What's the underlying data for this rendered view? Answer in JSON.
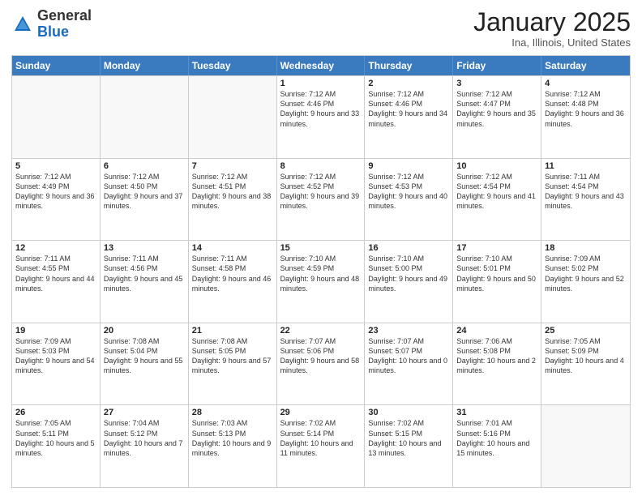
{
  "logo": {
    "general": "General",
    "blue": "Blue"
  },
  "header": {
    "title": "January 2025",
    "subtitle": "Ina, Illinois, United States"
  },
  "weekdays": [
    "Sunday",
    "Monday",
    "Tuesday",
    "Wednesday",
    "Thursday",
    "Friday",
    "Saturday"
  ],
  "weeks": [
    [
      {
        "day": "",
        "info": ""
      },
      {
        "day": "",
        "info": ""
      },
      {
        "day": "",
        "info": ""
      },
      {
        "day": "1",
        "info": "Sunrise: 7:12 AM\nSunset: 4:46 PM\nDaylight: 9 hours and 33 minutes."
      },
      {
        "day": "2",
        "info": "Sunrise: 7:12 AM\nSunset: 4:46 PM\nDaylight: 9 hours and 34 minutes."
      },
      {
        "day": "3",
        "info": "Sunrise: 7:12 AM\nSunset: 4:47 PM\nDaylight: 9 hours and 35 minutes."
      },
      {
        "day": "4",
        "info": "Sunrise: 7:12 AM\nSunset: 4:48 PM\nDaylight: 9 hours and 36 minutes."
      }
    ],
    [
      {
        "day": "5",
        "info": "Sunrise: 7:12 AM\nSunset: 4:49 PM\nDaylight: 9 hours and 36 minutes."
      },
      {
        "day": "6",
        "info": "Sunrise: 7:12 AM\nSunset: 4:50 PM\nDaylight: 9 hours and 37 minutes."
      },
      {
        "day": "7",
        "info": "Sunrise: 7:12 AM\nSunset: 4:51 PM\nDaylight: 9 hours and 38 minutes."
      },
      {
        "day": "8",
        "info": "Sunrise: 7:12 AM\nSunset: 4:52 PM\nDaylight: 9 hours and 39 minutes."
      },
      {
        "day": "9",
        "info": "Sunrise: 7:12 AM\nSunset: 4:53 PM\nDaylight: 9 hours and 40 minutes."
      },
      {
        "day": "10",
        "info": "Sunrise: 7:12 AM\nSunset: 4:54 PM\nDaylight: 9 hours and 41 minutes."
      },
      {
        "day": "11",
        "info": "Sunrise: 7:11 AM\nSunset: 4:54 PM\nDaylight: 9 hours and 43 minutes."
      }
    ],
    [
      {
        "day": "12",
        "info": "Sunrise: 7:11 AM\nSunset: 4:55 PM\nDaylight: 9 hours and 44 minutes."
      },
      {
        "day": "13",
        "info": "Sunrise: 7:11 AM\nSunset: 4:56 PM\nDaylight: 9 hours and 45 minutes."
      },
      {
        "day": "14",
        "info": "Sunrise: 7:11 AM\nSunset: 4:58 PM\nDaylight: 9 hours and 46 minutes."
      },
      {
        "day": "15",
        "info": "Sunrise: 7:10 AM\nSunset: 4:59 PM\nDaylight: 9 hours and 48 minutes."
      },
      {
        "day": "16",
        "info": "Sunrise: 7:10 AM\nSunset: 5:00 PM\nDaylight: 9 hours and 49 minutes."
      },
      {
        "day": "17",
        "info": "Sunrise: 7:10 AM\nSunset: 5:01 PM\nDaylight: 9 hours and 50 minutes."
      },
      {
        "day": "18",
        "info": "Sunrise: 7:09 AM\nSunset: 5:02 PM\nDaylight: 9 hours and 52 minutes."
      }
    ],
    [
      {
        "day": "19",
        "info": "Sunrise: 7:09 AM\nSunset: 5:03 PM\nDaylight: 9 hours and 54 minutes."
      },
      {
        "day": "20",
        "info": "Sunrise: 7:08 AM\nSunset: 5:04 PM\nDaylight: 9 hours and 55 minutes."
      },
      {
        "day": "21",
        "info": "Sunrise: 7:08 AM\nSunset: 5:05 PM\nDaylight: 9 hours and 57 minutes."
      },
      {
        "day": "22",
        "info": "Sunrise: 7:07 AM\nSunset: 5:06 PM\nDaylight: 9 hours and 58 minutes."
      },
      {
        "day": "23",
        "info": "Sunrise: 7:07 AM\nSunset: 5:07 PM\nDaylight: 10 hours and 0 minutes."
      },
      {
        "day": "24",
        "info": "Sunrise: 7:06 AM\nSunset: 5:08 PM\nDaylight: 10 hours and 2 minutes."
      },
      {
        "day": "25",
        "info": "Sunrise: 7:05 AM\nSunset: 5:09 PM\nDaylight: 10 hours and 4 minutes."
      }
    ],
    [
      {
        "day": "26",
        "info": "Sunrise: 7:05 AM\nSunset: 5:11 PM\nDaylight: 10 hours and 5 minutes."
      },
      {
        "day": "27",
        "info": "Sunrise: 7:04 AM\nSunset: 5:12 PM\nDaylight: 10 hours and 7 minutes."
      },
      {
        "day": "28",
        "info": "Sunrise: 7:03 AM\nSunset: 5:13 PM\nDaylight: 10 hours and 9 minutes."
      },
      {
        "day": "29",
        "info": "Sunrise: 7:02 AM\nSunset: 5:14 PM\nDaylight: 10 hours and 11 minutes."
      },
      {
        "day": "30",
        "info": "Sunrise: 7:02 AM\nSunset: 5:15 PM\nDaylight: 10 hours and 13 minutes."
      },
      {
        "day": "31",
        "info": "Sunrise: 7:01 AM\nSunset: 5:16 PM\nDaylight: 10 hours and 15 minutes."
      },
      {
        "day": "",
        "info": ""
      }
    ]
  ]
}
